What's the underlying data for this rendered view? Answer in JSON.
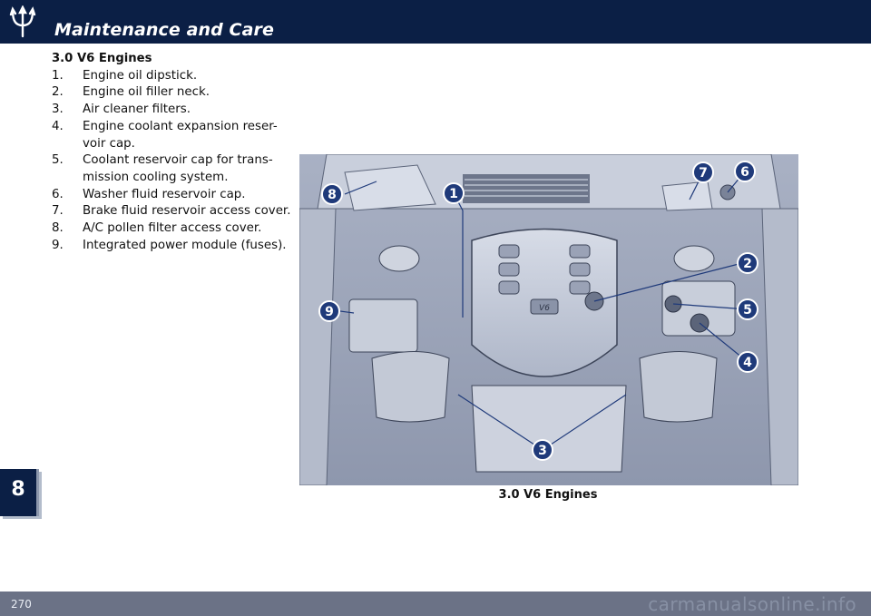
{
  "header": {
    "title": "Maintenance and Care",
    "logo_icon": "maserati-trident-icon"
  },
  "section": {
    "title": "3.0 V6 Engines",
    "items": [
      {
        "num": "1.",
        "text": "Engine oil dipstick."
      },
      {
        "num": "2.",
        "text": "Engine oil filler neck."
      },
      {
        "num": "3.",
        "text": "Air cleaner filters."
      },
      {
        "num": "4.",
        "text": "Engine coolant expansion reser-voir cap."
      },
      {
        "num": "5.",
        "text": "Coolant reservoir cap for trans-mission cooling system."
      },
      {
        "num": "6.",
        "text": "Washer fluid reservoir cap."
      },
      {
        "num": "7.",
        "text": "Brake fluid reservoir access cover."
      },
      {
        "num": "8.",
        "text": "A/C pollen filter access cover."
      },
      {
        "num": "9.",
        "text": "Integrated power module (fuses)."
      }
    ]
  },
  "figure": {
    "caption": "3.0 V6 Engines",
    "engine_badge": "V6",
    "callouts": [
      "1",
      "2",
      "3",
      "4",
      "5",
      "6",
      "7",
      "8",
      "9"
    ]
  },
  "chapter_tab": {
    "number": "8"
  },
  "footer": {
    "page_number": "270",
    "watermark": "carmanualsonline.info"
  },
  "colors": {
    "header_bg": "#0b1f45",
    "footer_bg": "#6b7286",
    "callout_fill": "#1f3a7a",
    "engine_tint": "#c5cbd9"
  }
}
